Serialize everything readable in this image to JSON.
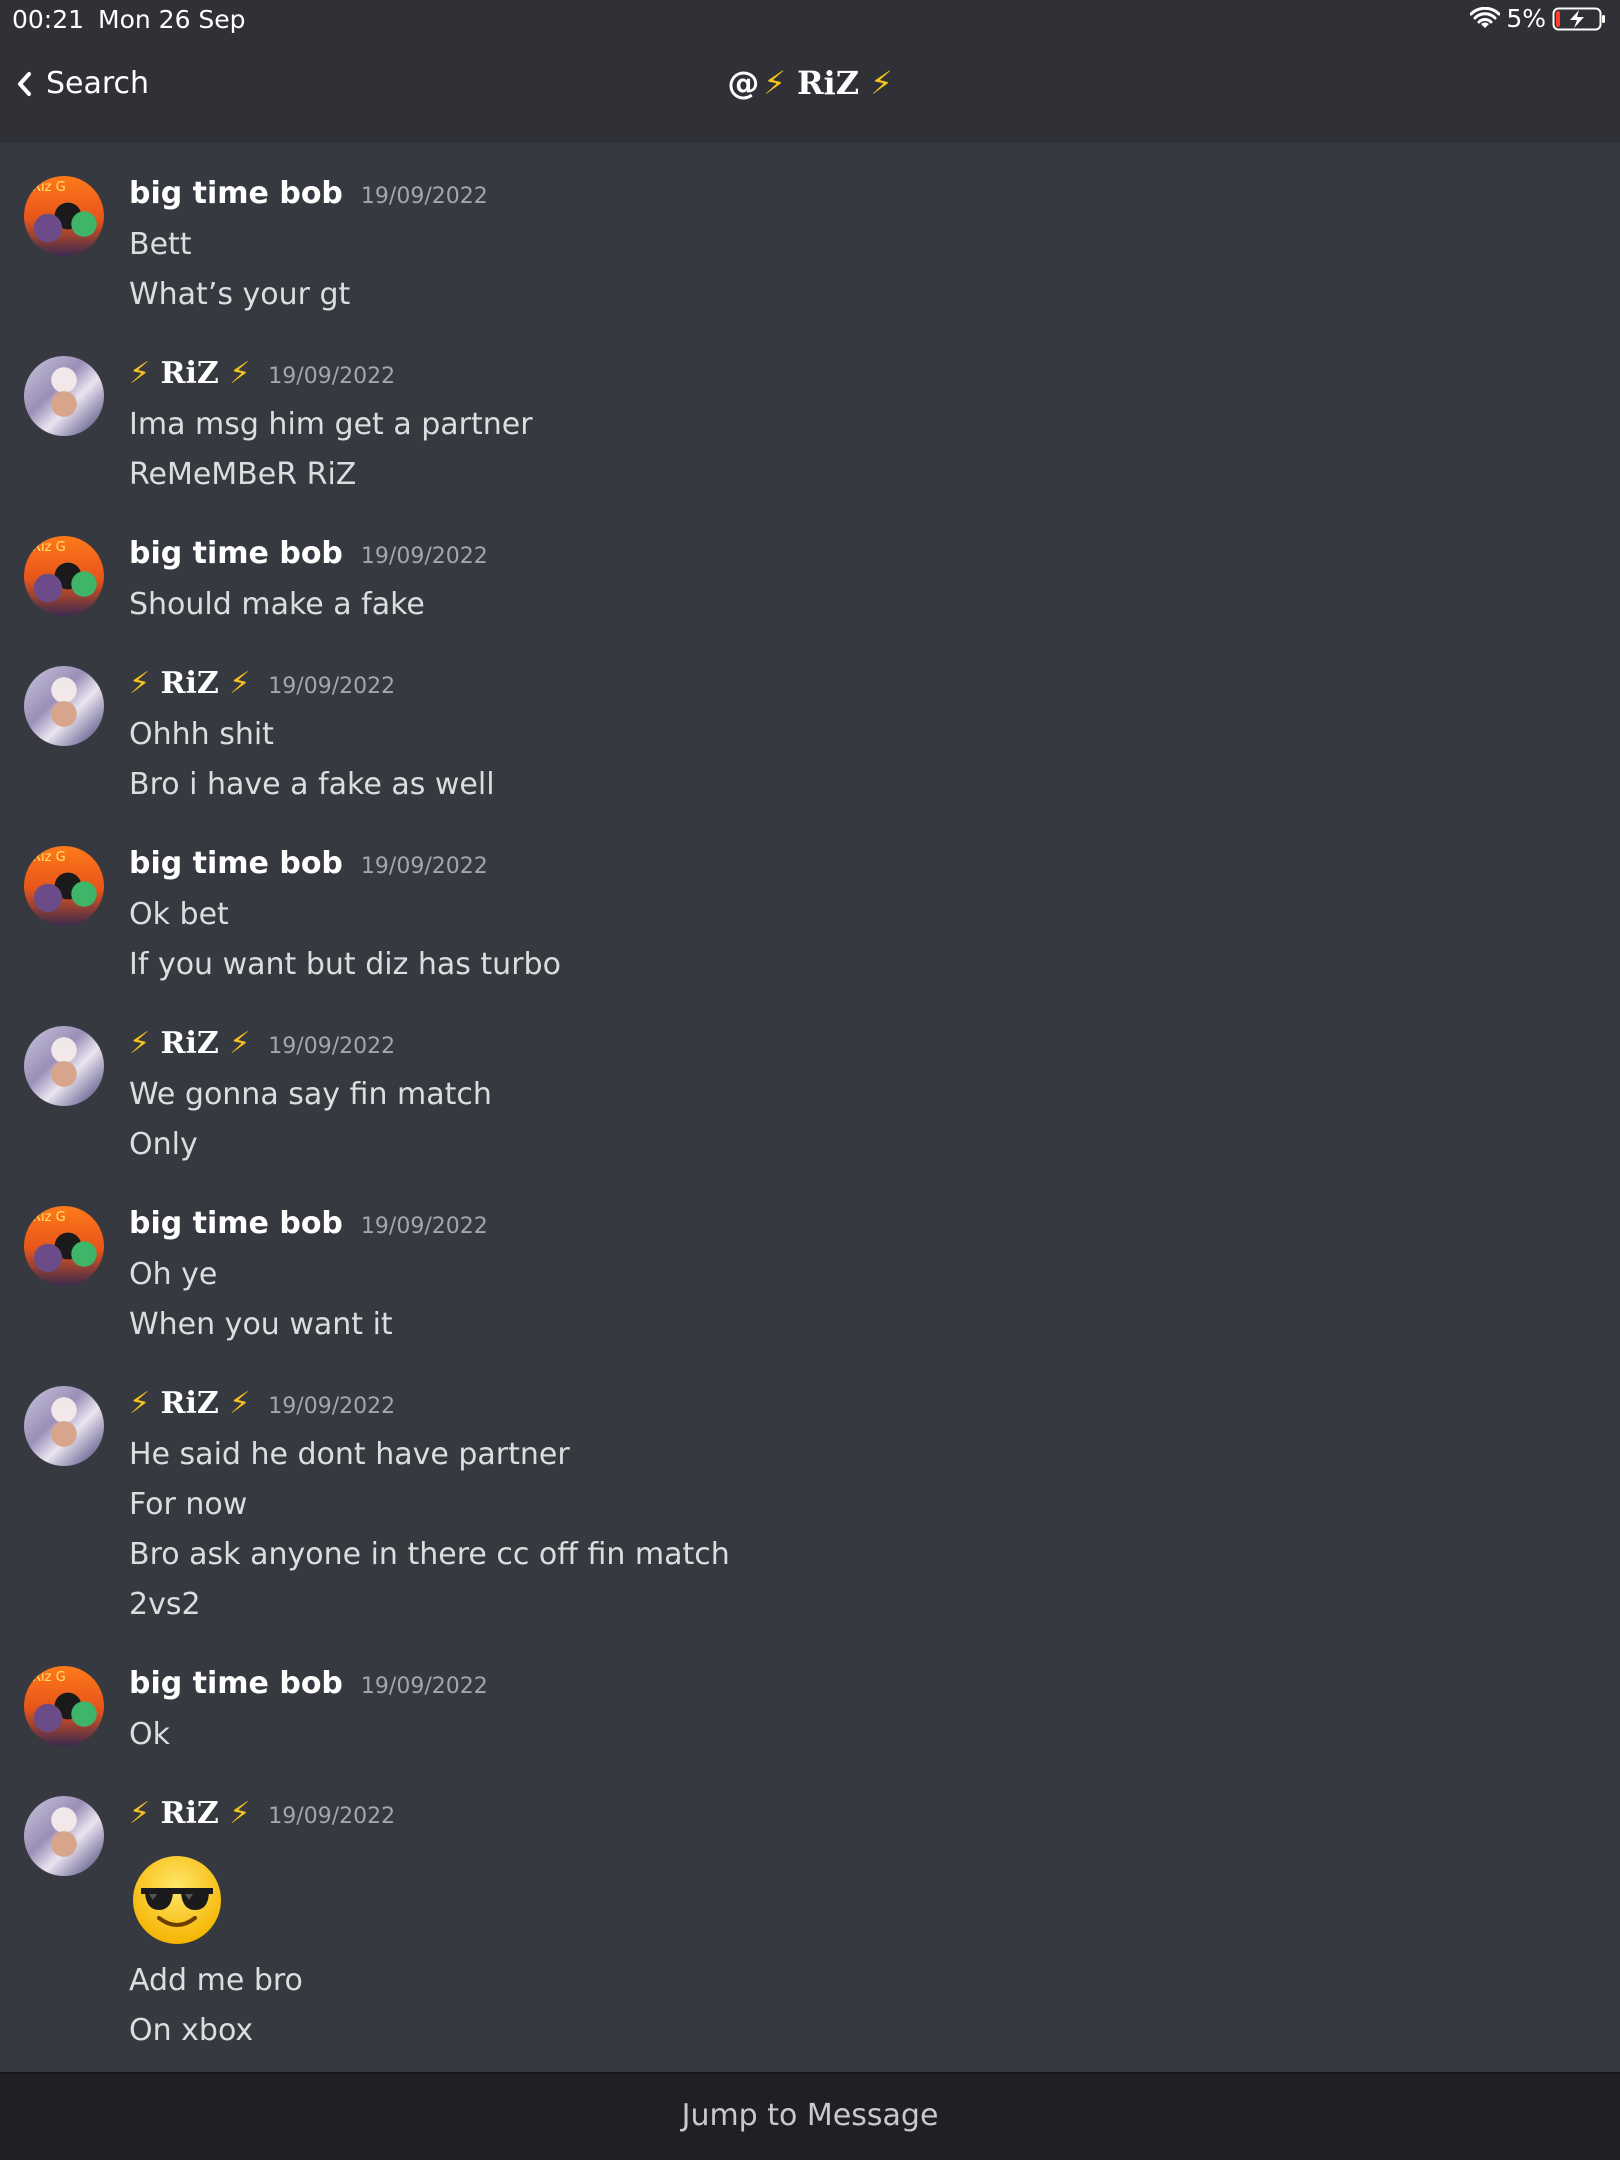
{
  "status": {
    "time": "00:21",
    "date": "Mon 26 Sep",
    "battery_pct": "5%"
  },
  "nav": {
    "back_label": "Search",
    "channel_at": "@",
    "channel_name": "RiZ",
    "bolt": "⚡"
  },
  "messages": [
    {
      "author": "big time bob",
      "time": "19/09/2022",
      "lines": [
        "Bett",
        "What’s your gt"
      ]
    },
    {
      "author": "RiZ",
      "time": "19/09/2022",
      "lines": [
        "Ima msg him get a partner",
        "ReMeMBeR RiZ"
      ]
    },
    {
      "author": "big time bob",
      "time": "19/09/2022",
      "lines": [
        "Should make a fake"
      ]
    },
    {
      "author": "RiZ",
      "time": "19/09/2022",
      "lines": [
        "Ohhh shit",
        "Bro i have a fake as well"
      ]
    },
    {
      "author": "big time bob",
      "time": "19/09/2022",
      "lines": [
        "Ok bet",
        "If you want but diz has turbo"
      ]
    },
    {
      "author": "RiZ",
      "time": "19/09/2022",
      "lines": [
        "We gonna say fin match",
        "Only"
      ]
    },
    {
      "author": "big time bob",
      "time": "19/09/2022",
      "lines": [
        "Oh ye",
        "When you want it"
      ]
    },
    {
      "author": "RiZ",
      "time": "19/09/2022",
      "lines": [
        "He said he dont have partner",
        "For now",
        "Bro ask anyone in there cc off fin match",
        "2vs2"
      ]
    },
    {
      "author": "big time bob",
      "time": "19/09/2022",
      "lines": [
        "Ok"
      ]
    },
    {
      "author": "RiZ",
      "time": "19/09/2022",
      "emoji": "sunglasses-emoji",
      "lines": [
        "Add me bro",
        "On xbox"
      ]
    }
  ],
  "footer": {
    "jump_label": "Jump to Message"
  },
  "colors": {
    "background": "#36393f",
    "header": "#2f3136",
    "bolt": "#f6c21d",
    "timestamp": "#a3a6aa"
  }
}
